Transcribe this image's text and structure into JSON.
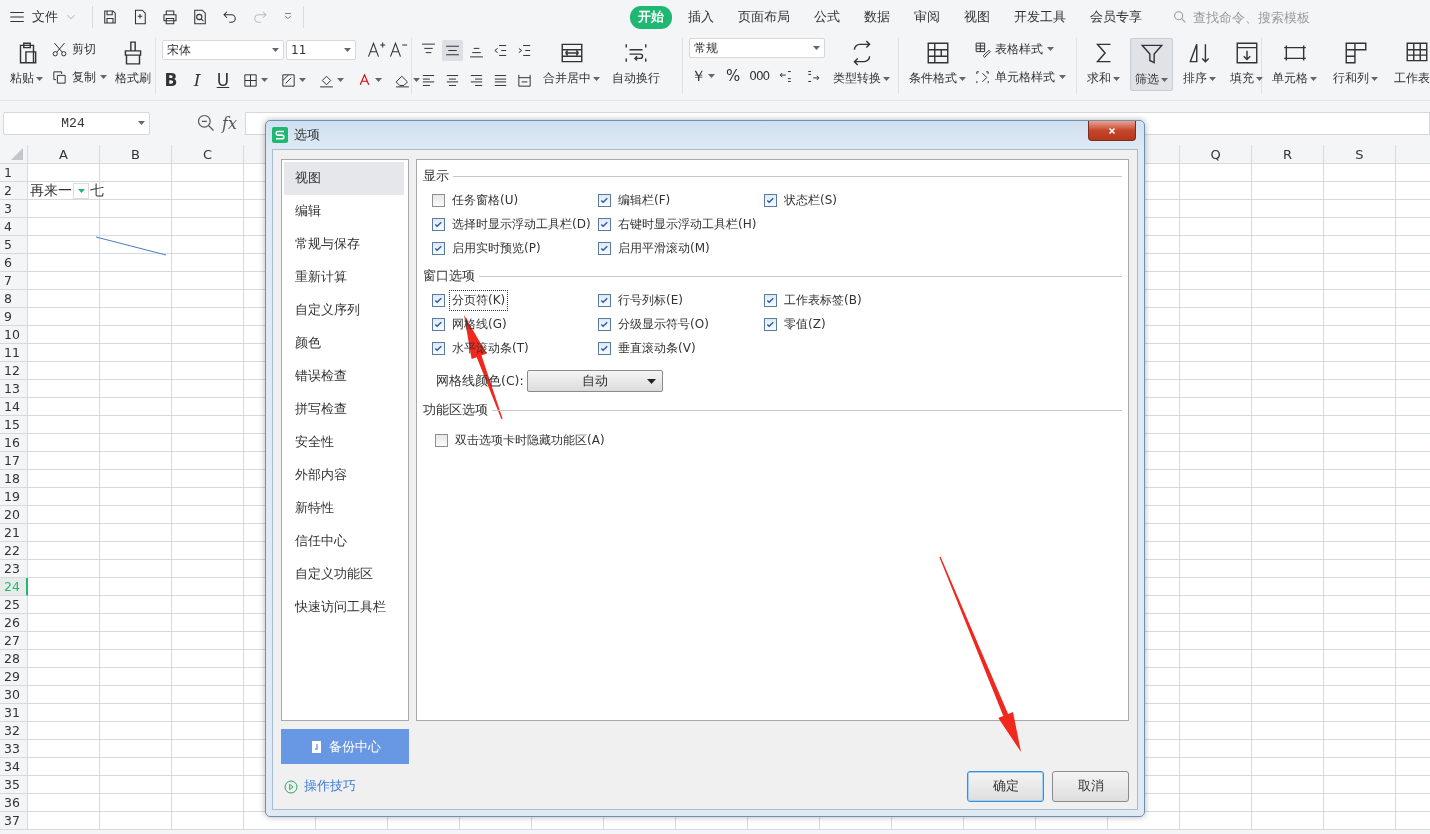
{
  "topbar": {
    "file_menu": "文件",
    "tabs": [
      {
        "label": "开始",
        "selected": true
      },
      {
        "label": "插入",
        "selected": false
      },
      {
        "label": "页面布局",
        "selected": false
      },
      {
        "label": "公式",
        "selected": false
      },
      {
        "label": "数据",
        "selected": false
      },
      {
        "label": "审阅",
        "selected": false
      },
      {
        "label": "视图",
        "selected": false
      },
      {
        "label": "开发工具",
        "selected": false
      },
      {
        "label": "会员专享",
        "selected": false
      }
    ],
    "search": {
      "placeholder": "查找命令、搜索模板"
    }
  },
  "ribbon": {
    "clipboard": {
      "paste": "粘贴",
      "cut": "剪切",
      "copy": "复制",
      "format_painter": "格式刷"
    },
    "font": {
      "name": "宋体",
      "size": "11",
      "styles": [
        "B",
        "I",
        "U"
      ]
    },
    "alignment": {
      "buttons": [
        {
          "selected": false
        },
        {
          "selected": true
        },
        {
          "selected": false
        },
        {
          "selected": false
        },
        {
          "selected": false
        },
        {
          "selected": false
        },
        {
          "selected": false
        },
        {
          "selected": false
        },
        {
          "selected": false
        },
        {
          "selected": false
        }
      ],
      "merge": "合并居中",
      "wrap": "自动换行"
    },
    "number": {
      "format": "常规",
      "symbols": [
        "￥",
        "%",
        "000"
      ],
      "convert": "类型转换"
    },
    "styles": {
      "conditional": "条件格式",
      "table_style": "表格样式",
      "cell_style": "单元格样式"
    },
    "editing": [
      {
        "label": "求和",
        "selected": false
      },
      {
        "label": "筛选",
        "selected": true
      },
      {
        "label": "排序",
        "selected": false
      },
      {
        "label": "填充",
        "selected": false
      }
    ],
    "cells": [
      "单元格",
      "行和列",
      "工作表"
    ]
  },
  "formula_bar": {
    "name_box": "M24",
    "fx": "fx"
  },
  "sheet": {
    "columns": [
      "A",
      "B",
      "C",
      "Q",
      "R",
      "S"
    ],
    "rows": [
      {
        "label": "1",
        "selected": false
      },
      {
        "label": "2",
        "selected": false
      },
      {
        "label": "3",
        "selected": false
      },
      {
        "label": "4",
        "selected": false
      },
      {
        "label": "5",
        "selected": false
      },
      {
        "label": "6",
        "selected": false
      },
      {
        "label": "7",
        "selected": false
      },
      {
        "label": "8",
        "selected": false
      },
      {
        "label": "9",
        "selected": false
      },
      {
        "label": "10",
        "selected": false
      },
      {
        "label": "11",
        "selected": false
      },
      {
        "label": "12",
        "selected": false
      },
      {
        "label": "13",
        "selected": false
      },
      {
        "label": "14",
        "selected": false
      },
      {
        "label": "15",
        "selected": false
      },
      {
        "label": "16",
        "selected": false
      },
      {
        "label": "17",
        "selected": false
      },
      {
        "label": "18",
        "selected": false
      },
      {
        "label": "19",
        "selected": false
      },
      {
        "label": "20",
        "selected": false
      },
      {
        "label": "21",
        "selected": false
      },
      {
        "label": "22",
        "selected": false
      },
      {
        "label": "23",
        "selected": false
      },
      {
        "label": "24",
        "selected": true
      },
      {
        "label": "25",
        "selected": false
      },
      {
        "label": "26",
        "selected": false
      },
      {
        "label": "27",
        "selected": false
      },
      {
        "label": "28",
        "selected": false
      },
      {
        "label": "29",
        "selected": false
      },
      {
        "label": "30",
        "selected": false
      },
      {
        "label": "31",
        "selected": false
      },
      {
        "label": "32",
        "selected": false
      },
      {
        "label": "33",
        "selected": false
      },
      {
        "label": "34",
        "selected": false
      },
      {
        "label": "35",
        "selected": false
      },
      {
        "label": "36",
        "selected": false
      },
      {
        "label": "37",
        "selected": false
      }
    ],
    "cell_a2": {
      "text": "再来一",
      "text_after": "七"
    }
  },
  "dialog": {
    "title": "选项",
    "nav": [
      {
        "label": "视图",
        "selected": true
      },
      {
        "label": "编辑",
        "selected": false
      },
      {
        "label": "常规与保存",
        "selected": false
      },
      {
        "label": "重新计算",
        "selected": false
      },
      {
        "label": "自定义序列",
        "selected": false
      },
      {
        "label": "颜色",
        "selected": false
      },
      {
        "label": "错误检查",
        "selected": false
      },
      {
        "label": "拼写检查",
        "selected": false
      },
      {
        "label": "安全性",
        "selected": false
      },
      {
        "label": "外部内容",
        "selected": false
      },
      {
        "label": "新特性",
        "selected": false
      },
      {
        "label": "信任中心",
        "selected": false
      },
      {
        "label": "自定义功能区",
        "selected": false
      },
      {
        "label": "快速访问工具栏",
        "selected": false
      }
    ],
    "backup": "备份中心",
    "tips": "操作技巧",
    "sections": [
      {
        "title": "显示",
        "rows": [
          [
            {
              "label": "任务窗格(U)",
              "checked": false,
              "focused": false
            },
            {
              "label": "编辑栏(F)",
              "checked": true,
              "focused": false
            },
            {
              "label": "状态栏(S)",
              "checked": true,
              "focused": false
            }
          ],
          [
            {
              "label": "选择时显示浮动工具栏(D)",
              "checked": true,
              "focused": false
            },
            {
              "label": "右键时显示浮动工具栏(H)",
              "checked": true,
              "focused": false
            }
          ],
          [
            {
              "label": "启用实时预览(P)",
              "checked": true,
              "focused": false
            },
            {
              "label": "启用平滑滚动(M)",
              "checked": true,
              "focused": false
            }
          ]
        ]
      },
      {
        "title": "窗口选项",
        "rows": [
          [
            {
              "label": "分页符(K)",
              "checked": true,
              "focused": true
            },
            {
              "label": "行号列标(E)",
              "checked": true,
              "focused": false
            },
            {
              "label": "工作表标签(B)",
              "checked": true,
              "focused": false
            }
          ],
          [
            {
              "label": "网格线(G)",
              "checked": true,
              "focused": false
            },
            {
              "label": "分级显示符号(O)",
              "checked": true,
              "focused": false
            },
            {
              "label": "零值(Z)",
              "checked": true,
              "focused": false
            }
          ],
          [
            {
              "label": "水平滚动条(T)",
              "checked": true,
              "focused": false
            },
            {
              "label": "垂直滚动条(V)",
              "checked": true,
              "focused": false
            }
          ]
        ],
        "select": {
          "label": "网格线颜色(C):",
          "value": "自动"
        }
      },
      {
        "title": "功能区选项",
        "rows": [
          [
            {
              "label": "双击选项卡时隐藏功能区(A)",
              "checked": false,
              "focused": false
            }
          ]
        ]
      }
    ],
    "ok": "确定",
    "cancel": "取消"
  }
}
